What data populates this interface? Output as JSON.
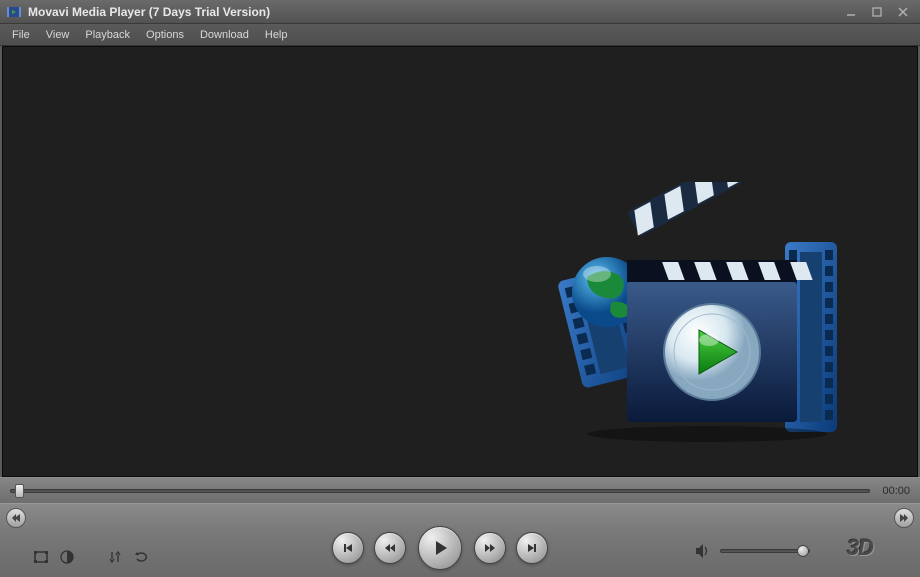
{
  "window": {
    "title": "Movavi Media Player (7 Days Trial Version)"
  },
  "menu": {
    "items": [
      "File",
      "View",
      "Playback",
      "Options",
      "Download",
      "Help"
    ]
  },
  "player": {
    "time": "00:00",
    "label_3d": "3D"
  }
}
